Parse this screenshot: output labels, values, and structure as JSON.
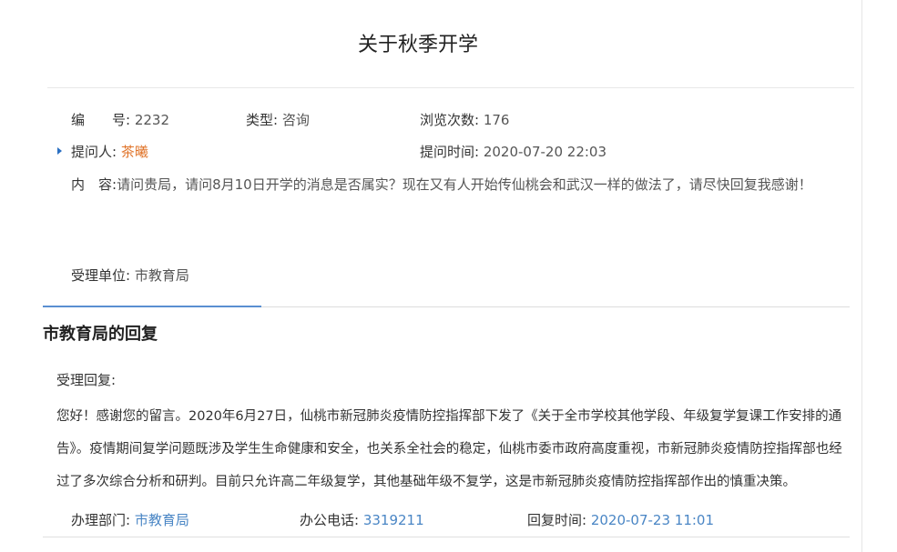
{
  "title": "关于秋季开学",
  "meta": {
    "number_label": "编　　号:",
    "number_value": "2232",
    "type_label": "类型:",
    "type_value": "咨询",
    "views_label": "浏览次数:",
    "views_value": "176",
    "asker_label": "提问人:",
    "asker_value": "茶曦",
    "ask_time_label": "提问时间:",
    "ask_time_value": "2020-07-20 22:03",
    "content_label": "内　容:",
    "content_value": "请问贵局，请问8月10日开学的消息是否属实？现在又有人开始传仙桃会和武汉一样的做法了，请尽快回复我感谢！",
    "dept_label": "受理单位:",
    "dept_value": "市教育局"
  },
  "reply": {
    "section_title": "市教育局的回复",
    "label": "受理回复:",
    "text": "您好！感谢您的留言。2020年6月27日，仙桃市新冠肺炎疫情防控指挥部下发了《关于全市学校其他学段、年级复学复课工作安排的通告》。疫情期间复学问题既涉及学生生命健康和安全，也关系全社会的稳定，仙桃市委市政府高度重视，市新冠肺炎疫情防控指挥部也经过了多次综合分析和研判。目前只允许高二年级复学，其他基础年级不复学，这是市新冠肺炎疫情防控指挥部作出的慎重决策。",
    "handler_label": "办理部门:",
    "handler_value": "市教育局",
    "phone_label": "办公电话:",
    "phone_value": "3319211",
    "reply_time_label": "回复时间:",
    "reply_time_value": "2020-07-23 11:01"
  },
  "colors": {
    "asker": "#e0742a",
    "link_blue": "#4a86c5",
    "tab_active": "#5a8fd1"
  }
}
